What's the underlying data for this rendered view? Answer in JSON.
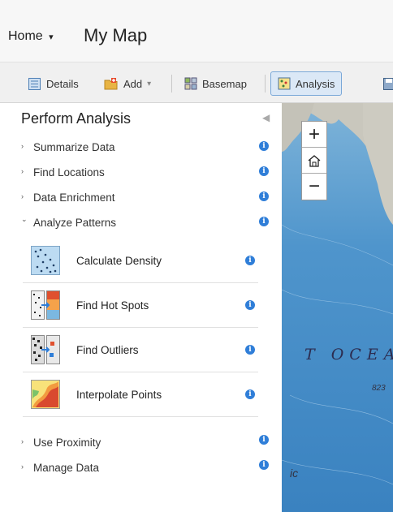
{
  "header": {
    "home_label": "Home",
    "home_caret": "▾",
    "map_title": "My Map"
  },
  "toolbar": {
    "details_label": "Details",
    "add_label": "Add",
    "add_caret": "▾",
    "basemap_label": "Basemap",
    "analysis_label": "Analysis",
    "active_tab": "Analysis"
  },
  "panel": {
    "title": "Perform Analysis",
    "collapse_glyph": "◀",
    "categories": [
      {
        "label": "Summarize Data",
        "expanded": false
      },
      {
        "label": "Find Locations",
        "expanded": false
      },
      {
        "label": "Data Enrichment",
        "expanded": false
      },
      {
        "label": "Analyze Patterns",
        "expanded": true
      },
      {
        "label": "Use Proximity",
        "expanded": false
      },
      {
        "label": "Manage Data",
        "expanded": false
      }
    ],
    "arrow_collapsed": "›",
    "arrow_expanded": "⌄",
    "tools": [
      {
        "label": "Calculate Density",
        "icon": "density-icon"
      },
      {
        "label": "Find Hot Spots",
        "icon": "hot-spots-icon"
      },
      {
        "label": "Find Outliers",
        "icon": "outliers-icon"
      },
      {
        "label": "Interpolate Points",
        "icon": "interpolate-icon"
      }
    ],
    "info_glyph": "i"
  },
  "map": {
    "zoom_in": "+",
    "zoom_out": "−",
    "ocean_label": "T OCEAN",
    "depth_label": "823",
    "partial_label": "ic",
    "colors": {
      "ocean": "#5a9fd0",
      "land": "#c9c7bd",
      "accent": "#2f7ed8"
    }
  }
}
